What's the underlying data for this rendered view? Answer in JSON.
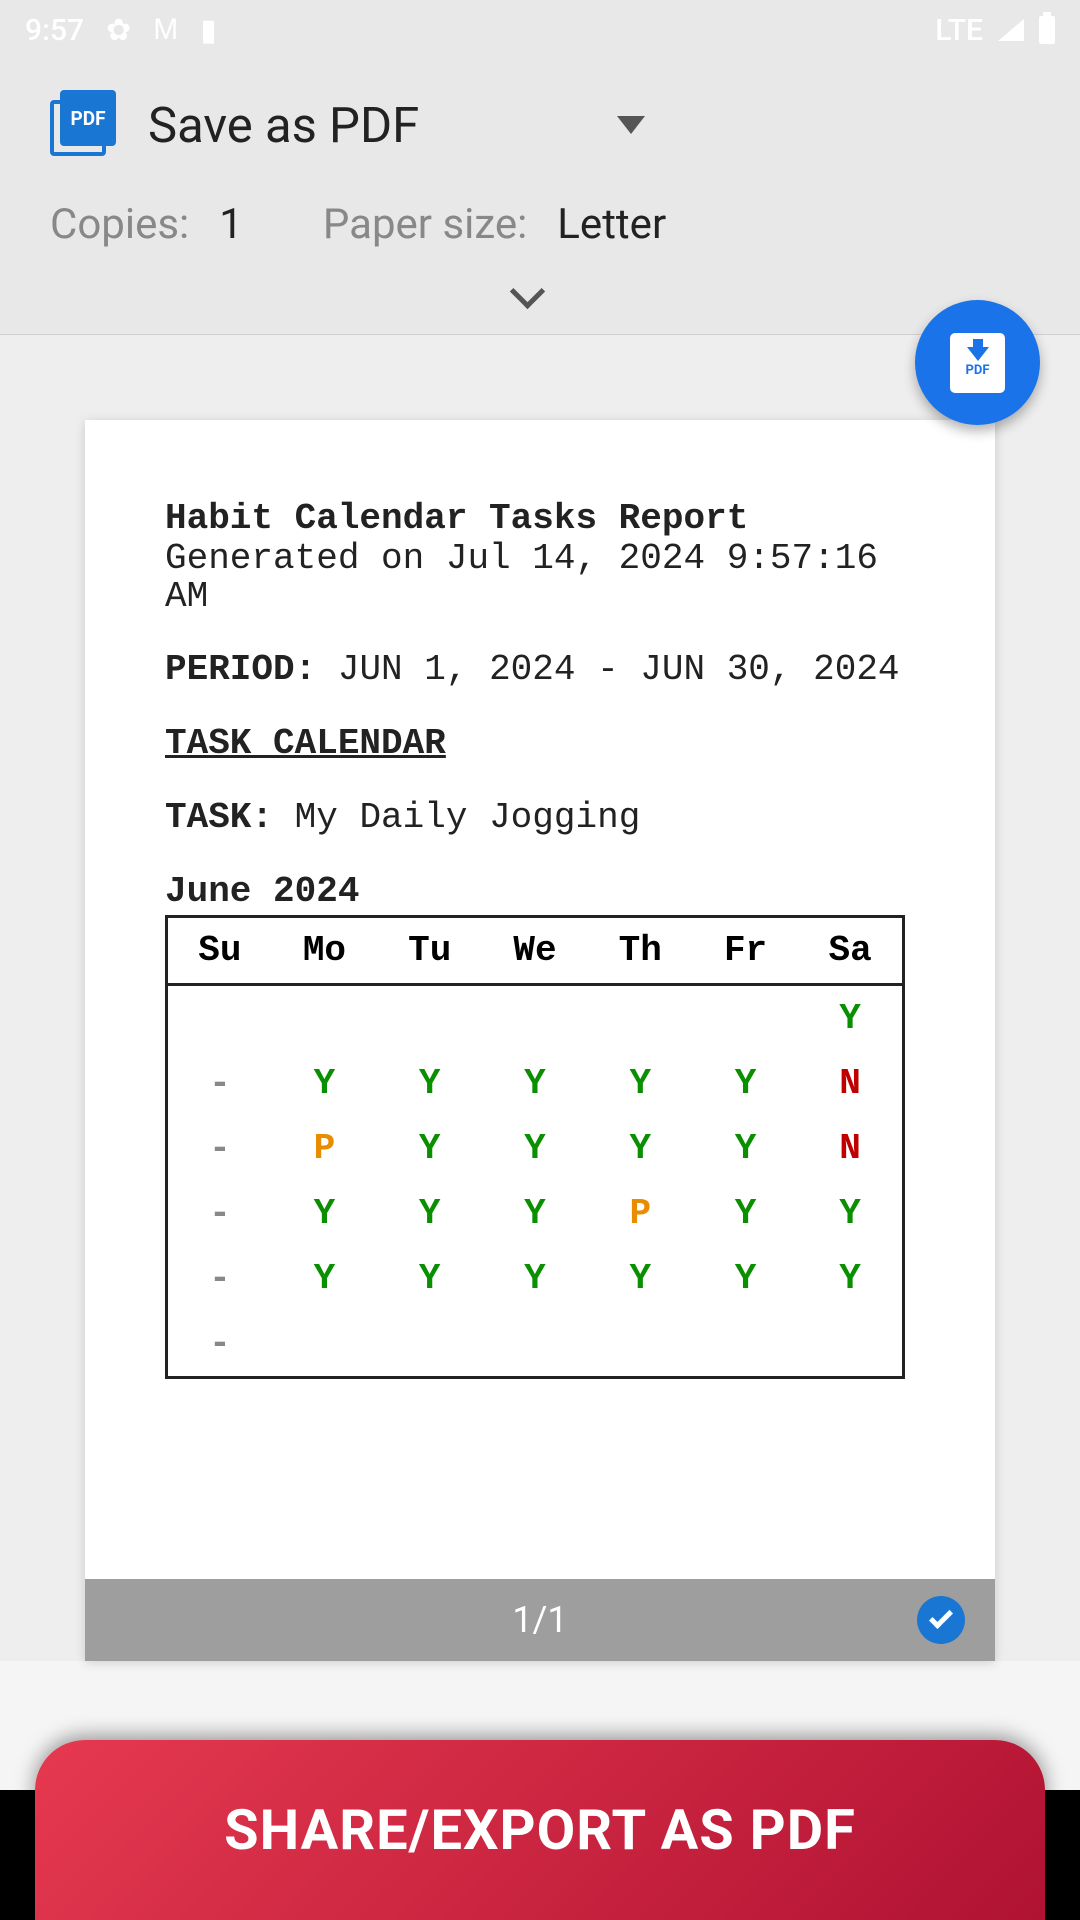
{
  "status_bar": {
    "time": "9:57",
    "lte": "LTE"
  },
  "header": {
    "printer_label": "Save as PDF",
    "copies_label": "Copies:",
    "copies_value": "1",
    "paper_label": "Paper size:",
    "paper_value": "Letter"
  },
  "fab": {
    "pdf_label": "PDF"
  },
  "report": {
    "title": "Habit Calendar Tasks Report",
    "generated": "Generated on Jul 14, 2024 9:57:16 AM",
    "period_label": "PERIOD:",
    "period_value": "JUN 1, 2024 - JUN 30, 2024",
    "section_title": "TASK CALENDAR",
    "task_label": "TASK:",
    "task_value": "My Daily Jogging",
    "month": "June 2024",
    "days": [
      "Su",
      "Mo",
      "Tu",
      "We",
      "Th",
      "Fr",
      "Sa"
    ],
    "rows": [
      [
        "",
        "",
        "",
        "",
        "",
        "",
        "Y"
      ],
      [
        "-",
        "Y",
        "Y",
        "Y",
        "Y",
        "Y",
        "N"
      ],
      [
        "-",
        "P",
        "Y",
        "Y",
        "Y",
        "Y",
        "N"
      ],
      [
        "-",
        "Y",
        "Y",
        "Y",
        "P",
        "Y",
        "Y"
      ],
      [
        "-",
        "Y",
        "Y",
        "Y",
        "Y",
        "Y",
        "Y"
      ],
      [
        "-",
        "",
        "",
        "",
        "",
        "",
        ""
      ]
    ]
  },
  "preview": {
    "page_indicator": "1/1"
  },
  "banner": {
    "label": "SHARE/EXPORT AS PDF"
  }
}
